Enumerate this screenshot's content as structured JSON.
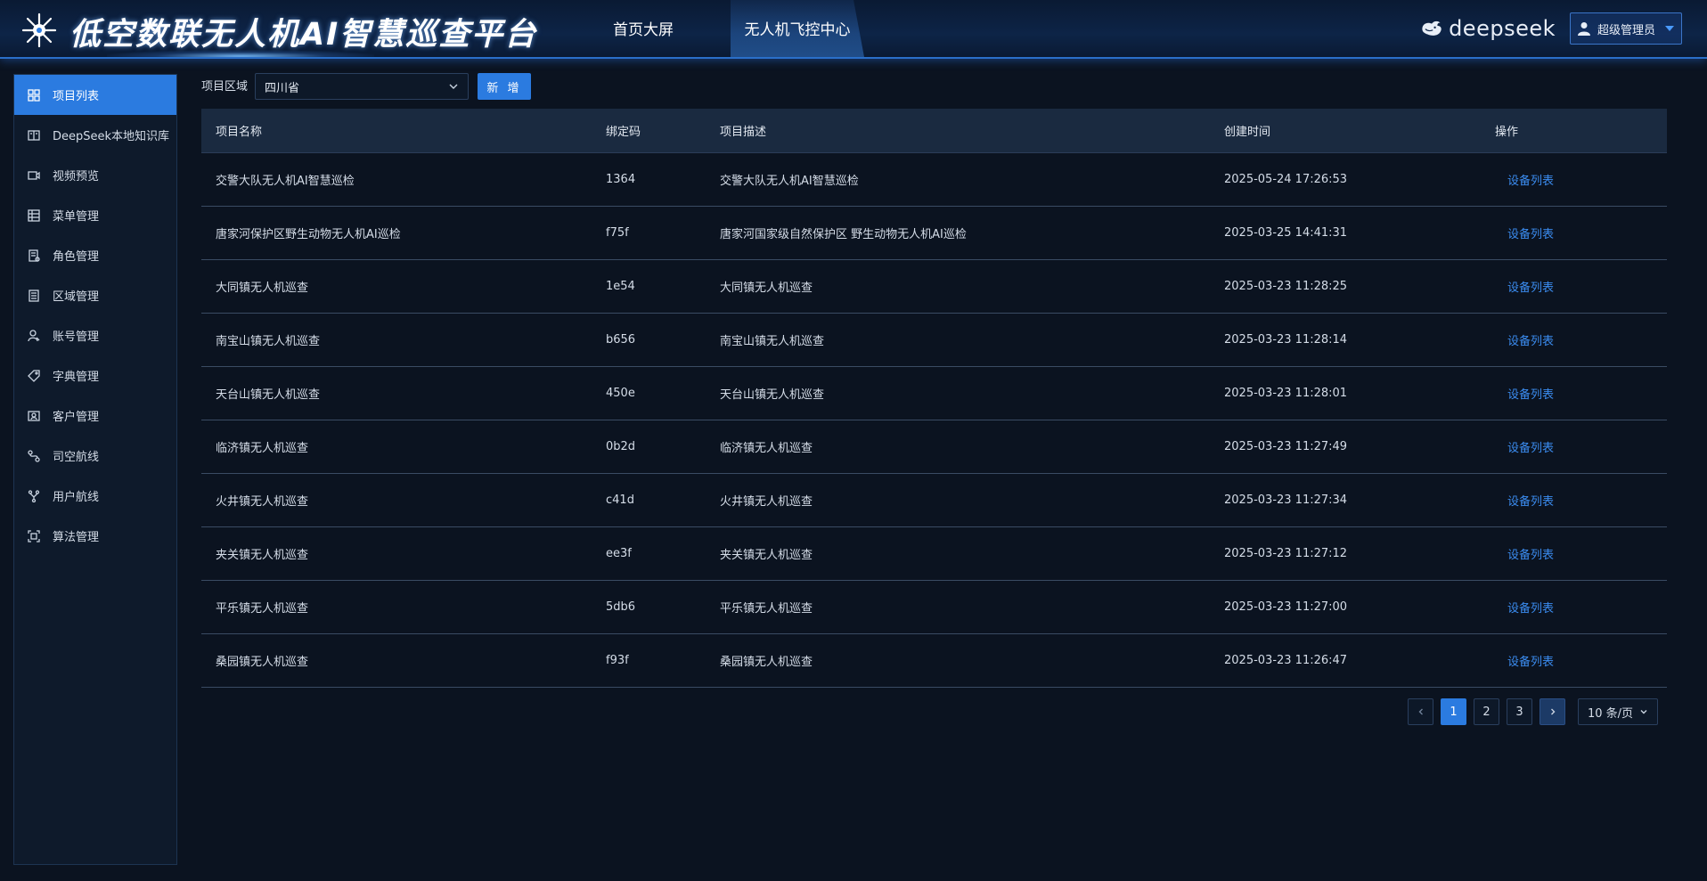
{
  "header": {
    "app_title": "低空数联无人机AI智慧巡查平台",
    "nav": [
      {
        "label": "首页大屏",
        "active": false
      },
      {
        "label": "无人机飞控中心",
        "active": true
      }
    ],
    "brand": "deepseek",
    "user": "超级管理员",
    "accent": "#2b7be0"
  },
  "sidebar": {
    "items": [
      {
        "label": "项目列表",
        "icon": "project-list-icon",
        "active": true
      },
      {
        "label": "DeepSeek本地知识库",
        "icon": "book-icon",
        "active": false
      },
      {
        "label": "视频预览",
        "icon": "video-icon",
        "active": false
      },
      {
        "label": "菜单管理",
        "icon": "grid-icon",
        "active": false
      },
      {
        "label": "角色管理",
        "icon": "role-icon",
        "active": false
      },
      {
        "label": "区域管理",
        "icon": "region-icon",
        "active": false
      },
      {
        "label": "账号管理",
        "icon": "account-icon",
        "active": false
      },
      {
        "label": "字典管理",
        "icon": "tag-icon",
        "active": false
      },
      {
        "label": "客户管理",
        "icon": "customer-icon",
        "active": false
      },
      {
        "label": "司空航线",
        "icon": "route-icon",
        "active": false
      },
      {
        "label": "用户航线",
        "icon": "branch-icon",
        "active": false
      },
      {
        "label": "算法管理",
        "icon": "scan-icon",
        "active": false
      }
    ]
  },
  "toolbar": {
    "region_label": "项目区域",
    "region_value": "四川省",
    "add_label": "新 增"
  },
  "table": {
    "columns": [
      "项目名称",
      "绑定码",
      "项目描述",
      "创建时间",
      "操作"
    ],
    "rows": [
      {
        "name": "交警大队无人机AI智慧巡检",
        "code": "1364",
        "desc": "交警大队无人机AI智慧巡检",
        "time": "2025-05-24 17:26:53",
        "op": "设备列表"
      },
      {
        "name": "唐家河保护区野生动物无人机AI巡检",
        "code": "f75f",
        "desc": "唐家河国家级自然保护区 野生动物无人机AI巡检",
        "time": "2025-03-25 14:41:31",
        "op": "设备列表"
      },
      {
        "name": "大同镇无人机巡查",
        "code": "1e54",
        "desc": "大同镇无人机巡查",
        "time": "2025-03-23 11:28:25",
        "op": "设备列表"
      },
      {
        "name": "南宝山镇无人机巡查",
        "code": "b656",
        "desc": "南宝山镇无人机巡查",
        "time": "2025-03-23 11:28:14",
        "op": "设备列表"
      },
      {
        "name": "天台山镇无人机巡查",
        "code": "450e",
        "desc": "天台山镇无人机巡查",
        "time": "2025-03-23 11:28:01",
        "op": "设备列表"
      },
      {
        "name": "临济镇无人机巡查",
        "code": "0b2d",
        "desc": "临济镇无人机巡查",
        "time": "2025-03-23 11:27:49",
        "op": "设备列表"
      },
      {
        "name": "火井镇无人机巡查",
        "code": "c41d",
        "desc": "火井镇无人机巡查",
        "time": "2025-03-23 11:27:34",
        "op": "设备列表"
      },
      {
        "name": "夹关镇无人机巡查",
        "code": "ee3f",
        "desc": "夹关镇无人机巡查",
        "time": "2025-03-23 11:27:12",
        "op": "设备列表"
      },
      {
        "name": "平乐镇无人机巡查",
        "code": "5db6",
        "desc": "平乐镇无人机巡查",
        "time": "2025-03-23 11:27:00",
        "op": "设备列表"
      },
      {
        "name": "桑园镇无人机巡查",
        "code": "f93f",
        "desc": "桑园镇无人机巡查",
        "time": "2025-03-23 11:26:47",
        "op": "设备列表"
      }
    ]
  },
  "pagination": {
    "pages": [
      "1",
      "2",
      "3"
    ],
    "current": "1",
    "page_size": "10 条/页"
  }
}
